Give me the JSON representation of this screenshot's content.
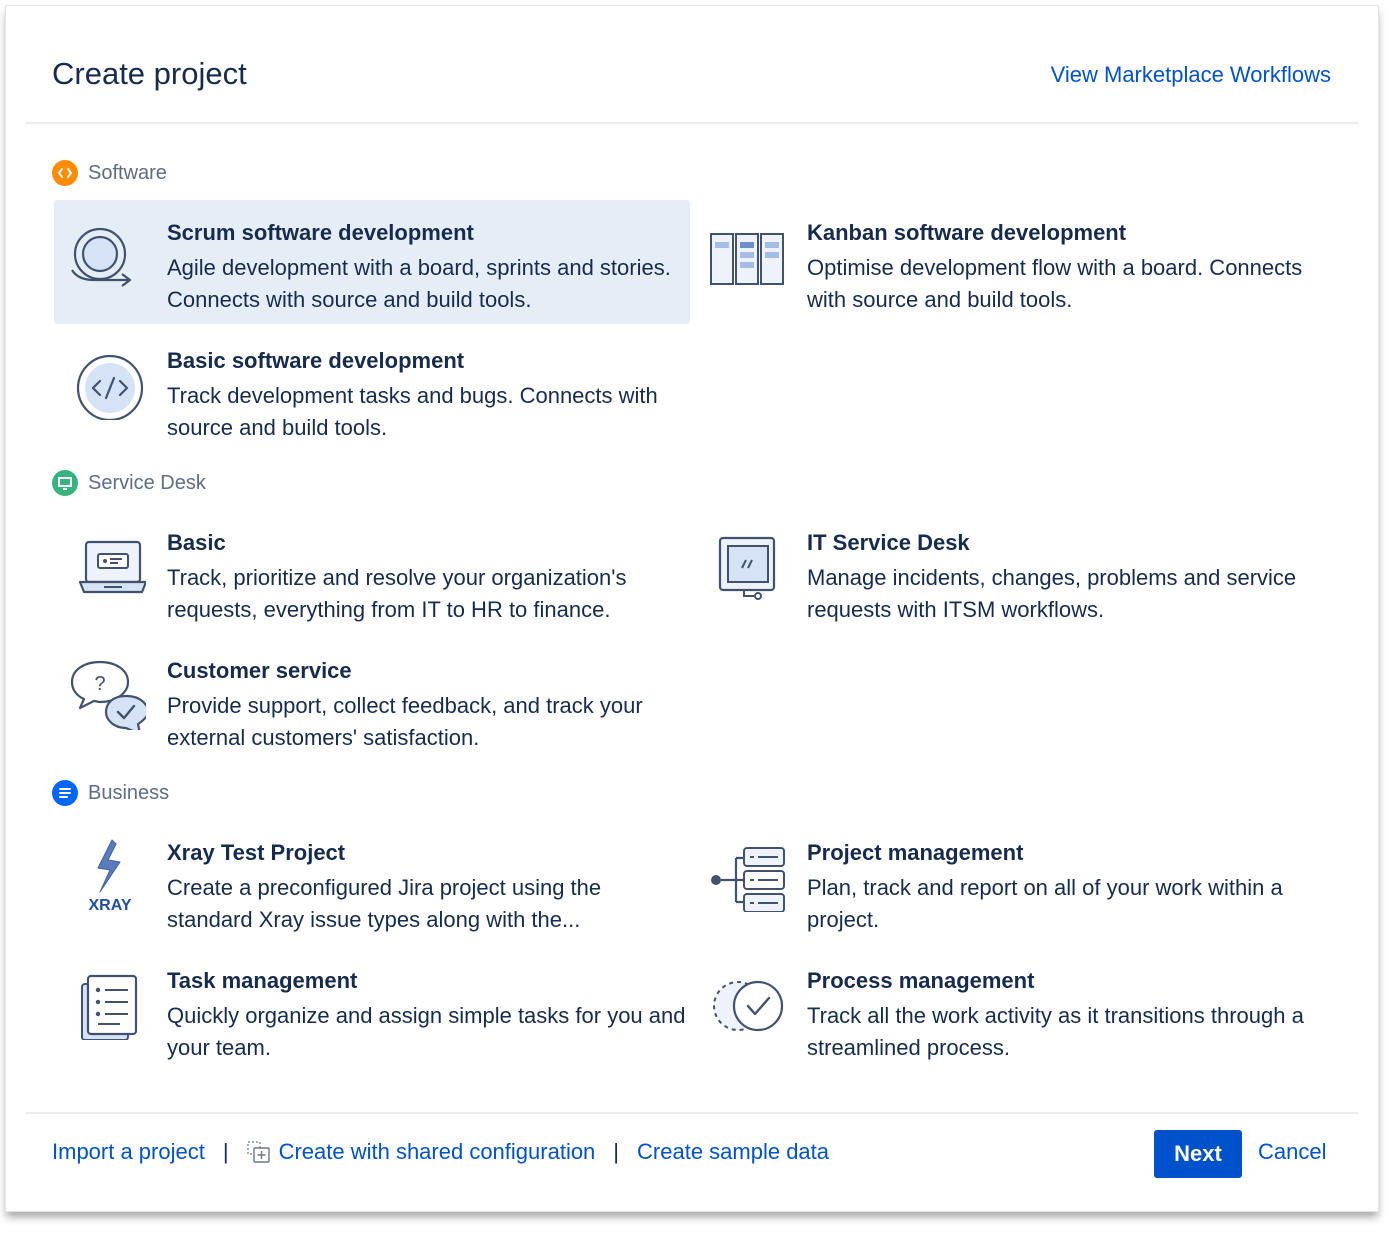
{
  "header": {
    "title": "Create project",
    "marketplace_link": "View Marketplace Workflows"
  },
  "sections": [
    {
      "label": "Software",
      "icon": "code-icon",
      "color": "#ff8b00",
      "items": [
        {
          "title": "Scrum software development",
          "description": "Agile development with a board, sprints and stories. Connects with source and build tools.",
          "icon": "scrum-cycle-icon",
          "selected": true
        },
        {
          "title": "Kanban software development",
          "description": "Optimise development flow with a board. Connects with source and build tools.",
          "icon": "kanban-board-icon"
        },
        {
          "title": "Basic software development",
          "description": "Track development tasks and bugs. Connects with source and build tools.",
          "icon": "code-circle-icon"
        }
      ]
    },
    {
      "label": "Service Desk",
      "icon": "monitor-icon",
      "color": "#36b37e",
      "items": [
        {
          "title": "Basic",
          "description": "Track, prioritize and resolve your organization's requests, everything from IT to HR to finance.",
          "icon": "laptop-icon"
        },
        {
          "title": "IT Service Desk",
          "description": "Manage incidents, changes, problems and service requests with ITSM workflows.",
          "icon": "computer-monitor-icon"
        },
        {
          "title": "Customer service",
          "description": "Provide support, collect feedback, and track your external customers' satisfaction.",
          "icon": "chat-bubbles-icon"
        }
      ]
    },
    {
      "label": "Business",
      "icon": "document-lines-icon",
      "color": "#0065ff",
      "items": [
        {
          "title": "Xray Test Project",
          "description": "Create a preconfigured Jira project using the standard Xray issue types along with the...",
          "icon": "xray-logo-icon",
          "logo_text": "XRAY"
        },
        {
          "title": "Project management",
          "description": "Plan, track and report on all of your work within a project.",
          "icon": "project-tree-icon"
        },
        {
          "title": "Task management",
          "description": "Quickly organize and assign simple tasks for you and your team.",
          "icon": "task-list-icon"
        },
        {
          "title": "Process management",
          "description": "Track all the work activity as it transitions through a streamlined process.",
          "icon": "process-check-icon"
        }
      ]
    }
  ],
  "footer": {
    "import_link": "Import a project",
    "separator": "|",
    "shared_config_link": "Create with shared configuration",
    "sample_data_link": "Create sample data",
    "next_label": "Next",
    "cancel_label": "Cancel"
  },
  "colors": {
    "primary": "#0052cc",
    "text": "#172b4d",
    "muted": "#5e6c84",
    "selected_bg": "#e5edf7"
  }
}
